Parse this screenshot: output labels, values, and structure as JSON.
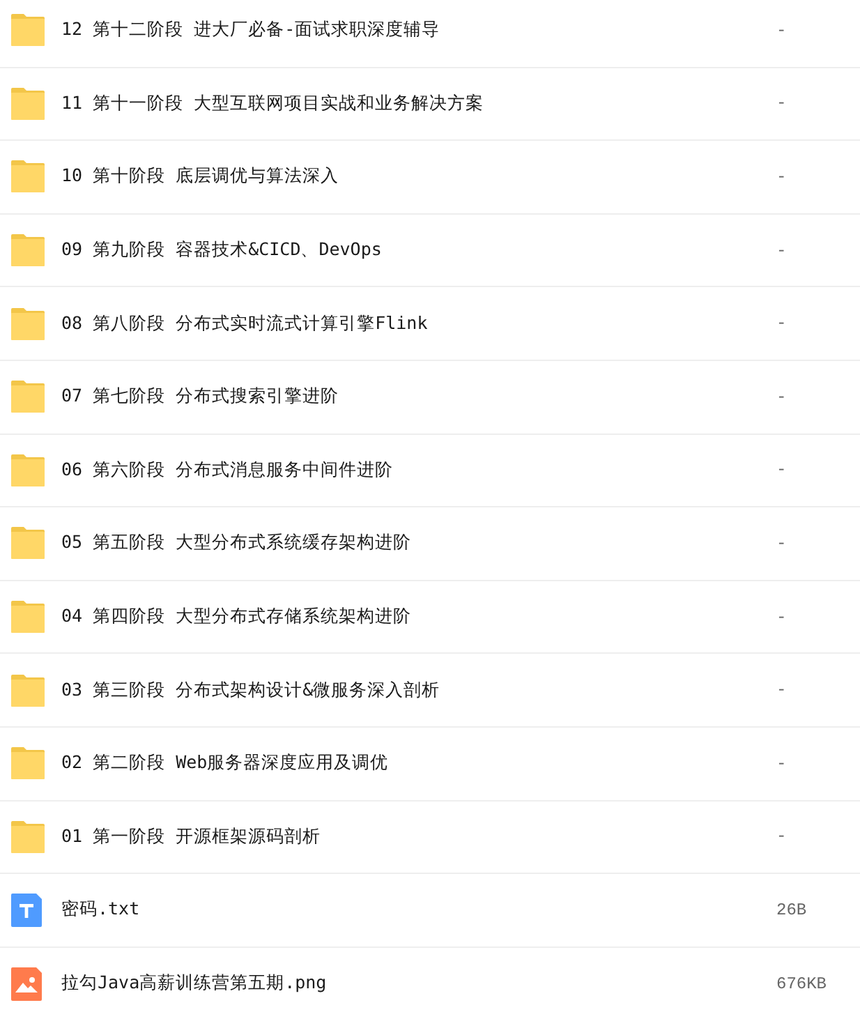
{
  "files": [
    {
      "kind": "folder",
      "name": "12 第十二阶段 进大厂必备-面试求职深度辅导",
      "size": "-"
    },
    {
      "kind": "folder",
      "name": "11 第十一阶段 大型互联网项目实战和业务解决方案",
      "size": "-"
    },
    {
      "kind": "folder",
      "name": "10 第十阶段 底层调优与算法深入",
      "size": "-"
    },
    {
      "kind": "folder",
      "name": "09 第九阶段 容器技术&CICD、DevOps",
      "size": "-"
    },
    {
      "kind": "folder",
      "name": "08 第八阶段 分布式实时流式计算引擎Flink",
      "size": "-"
    },
    {
      "kind": "folder",
      "name": "07 第七阶段 分布式搜索引擎进阶",
      "size": "-"
    },
    {
      "kind": "folder",
      "name": "06 第六阶段 分布式消息服务中间件进阶",
      "size": "-"
    },
    {
      "kind": "folder",
      "name": "05 第五阶段 大型分布式系统缓存架构进阶",
      "size": "-"
    },
    {
      "kind": "folder",
      "name": "04 第四阶段 大型分布式存储系统架构进阶",
      "size": "-"
    },
    {
      "kind": "folder",
      "name": "03 第三阶段 分布式架构设计&微服务深入剖析",
      "size": "-"
    },
    {
      "kind": "folder",
      "name": "02 第二阶段 Web服务器深度应用及调优",
      "size": "-"
    },
    {
      "kind": "folder",
      "name": "01 第一阶段 开源框架源码剖析",
      "size": "-"
    },
    {
      "kind": "text",
      "name": "密码.txt",
      "size": "26B"
    },
    {
      "kind": "image",
      "name": "拉勾Java高薪训练营第五期.png",
      "size": "676KB"
    }
  ]
}
